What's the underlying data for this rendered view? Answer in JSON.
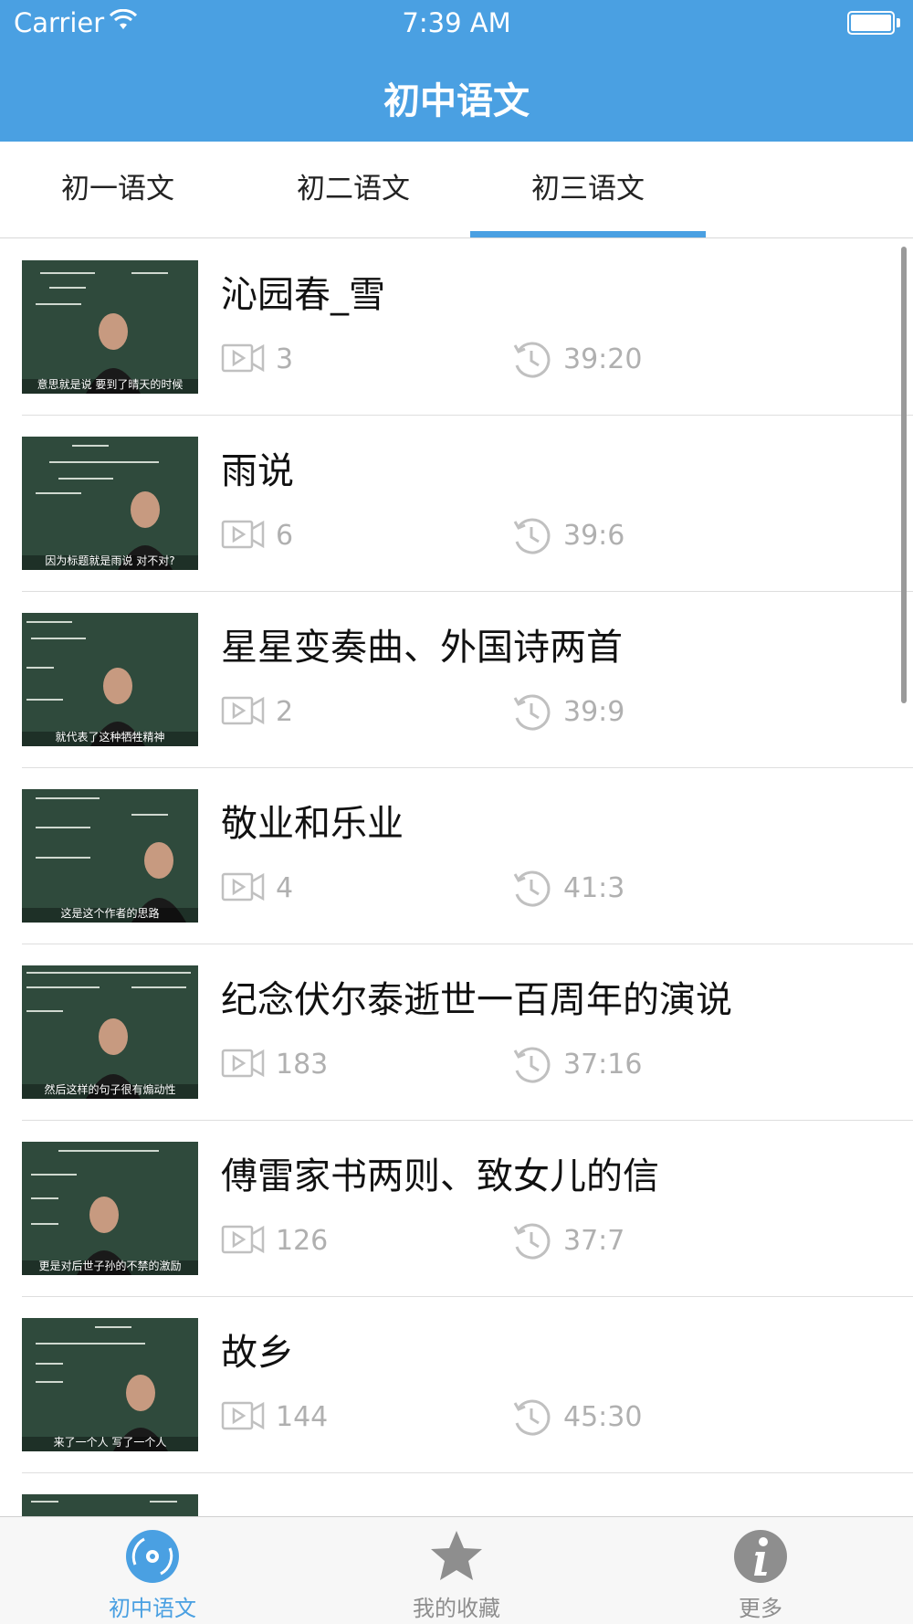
{
  "status_bar": {
    "carrier": "Carrier",
    "time": "7:39 AM"
  },
  "nav": {
    "title": "初中语文"
  },
  "tabs": [
    {
      "label": "初一语文",
      "selected": false
    },
    {
      "label": "初二语文",
      "selected": false
    },
    {
      "label": "初三语文",
      "selected": true
    }
  ],
  "colors": {
    "accent": "#4aa0e2",
    "meta_gray": "#b0b0b0",
    "chalkboard": "#2f4a3c"
  },
  "lessons": [
    {
      "title": "沁园春_雪",
      "videos": "3",
      "duration": "39:20",
      "subtitle": "意思就是说 要到了晴天的时候"
    },
    {
      "title": "雨说",
      "videos": "6",
      "duration": "39:6",
      "subtitle": "因为标题就是雨说 对不对?"
    },
    {
      "title": "星星变奏曲、外国诗两首",
      "videos": "2",
      "duration": "39:9",
      "subtitle": "就代表了这种牺牲精神"
    },
    {
      "title": "敬业和乐业",
      "videos": "4",
      "duration": "41:3",
      "subtitle": "这是这个作者的思路"
    },
    {
      "title": "纪念伏尔泰逝世一百周年的演说",
      "videos": "183",
      "duration": "37:16",
      "subtitle": "然后这样的句子很有煽动性"
    },
    {
      "title": "傅雷家书两则、致女儿的信",
      "videos": "126",
      "duration": "37:7",
      "subtitle": "更是对后世子孙的不禁的激励"
    },
    {
      "title": "故乡",
      "videos": "144",
      "duration": "45:30",
      "subtitle": "来了一个人 写了一个人"
    }
  ],
  "tabbar": {
    "items": [
      {
        "label": "初中语文",
        "icon": "disc-icon",
        "selected": true
      },
      {
        "label": "我的收藏",
        "icon": "star-icon",
        "selected": false
      },
      {
        "label": "更多",
        "icon": "info-icon",
        "selected": false
      }
    ]
  }
}
